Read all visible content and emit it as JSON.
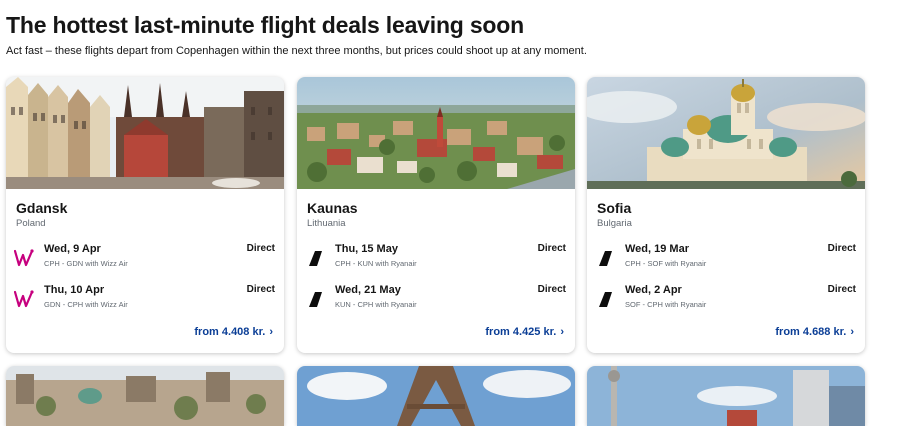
{
  "header": {
    "title": "The hottest last-minute flight deals leaving soon",
    "subtitle": "Act fast – these flights depart from Copenhagen within the next three months, but prices could shoot up at any moment."
  },
  "deals": [
    {
      "city": "Gdansk",
      "country": "Poland",
      "flights": [
        {
          "date": "Wed, 9 Apr",
          "route": "CPH - GDN with Wizz Air",
          "type": "Direct",
          "airline_icon": "wizz-air-logo-icon"
        },
        {
          "date": "Thu, 10 Apr",
          "route": "GDN - CPH with Wizz Air",
          "type": "Direct",
          "airline_icon": "wizz-air-logo-icon"
        }
      ],
      "price": "from 4.408 kr."
    },
    {
      "city": "Kaunas",
      "country": "Lithuania",
      "flights": [
        {
          "date": "Thu, 15 May",
          "route": "CPH - KUN with Ryanair",
          "type": "Direct",
          "airline_icon": "ryanair-tail-icon"
        },
        {
          "date": "Wed, 21 May",
          "route": "KUN - CPH with Ryanair",
          "type": "Direct",
          "airline_icon": "ryanair-tail-icon"
        }
      ],
      "price": "from 4.425 kr."
    },
    {
      "city": "Sofia",
      "country": "Bulgaria",
      "flights": [
        {
          "date": "Wed, 19 Mar",
          "route": "CPH - SOF with Ryanair",
          "type": "Direct",
          "airline_icon": "ryanair-tail-icon"
        },
        {
          "date": "Wed, 2 Apr",
          "route": "SOF - CPH with Ryanair",
          "type": "Direct",
          "airline_icon": "ryanair-tail-icon"
        }
      ],
      "price": "from 4.688 kr."
    }
  ],
  "icons": {
    "price_chevron": "chevron-right-icon"
  },
  "colors": {
    "price_link": "#0b3e96",
    "wizz_air": "#c6007e",
    "ryanair": "#0d0d0d",
    "muted_text": "#626971"
  }
}
